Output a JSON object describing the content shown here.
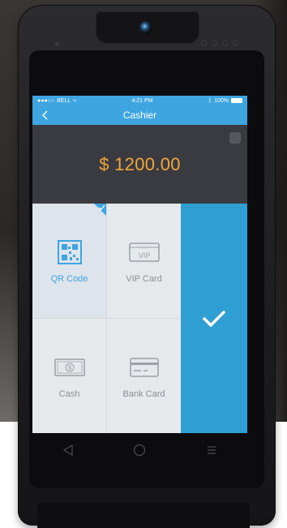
{
  "status_bar": {
    "carrier": "BELL",
    "time": "4:21 PM",
    "battery": "100%"
  },
  "header": {
    "title": "Cashier"
  },
  "amount": {
    "value": "$ 1200.00"
  },
  "payment_options": [
    {
      "label": "QR Code",
      "icon": "qr-code-icon",
      "selected": true
    },
    {
      "label": "VIP Card",
      "icon": "vip-card-icon",
      "selected": false
    },
    {
      "label": "Cash",
      "icon": "cash-icon",
      "selected": false
    },
    {
      "label": "Bank Card",
      "icon": "bank-card-icon",
      "selected": false
    }
  ],
  "confirm": {
    "icon": "checkmark-icon"
  },
  "device_nav": [
    "back-triangle-icon",
    "home-circle-icon",
    "menu-lines-icon"
  ],
  "colors": {
    "accent": "#3ea5e1",
    "confirm": "#2f9fd3",
    "amount_text": "#f1a736",
    "amount_panel": "#3a3a41"
  }
}
